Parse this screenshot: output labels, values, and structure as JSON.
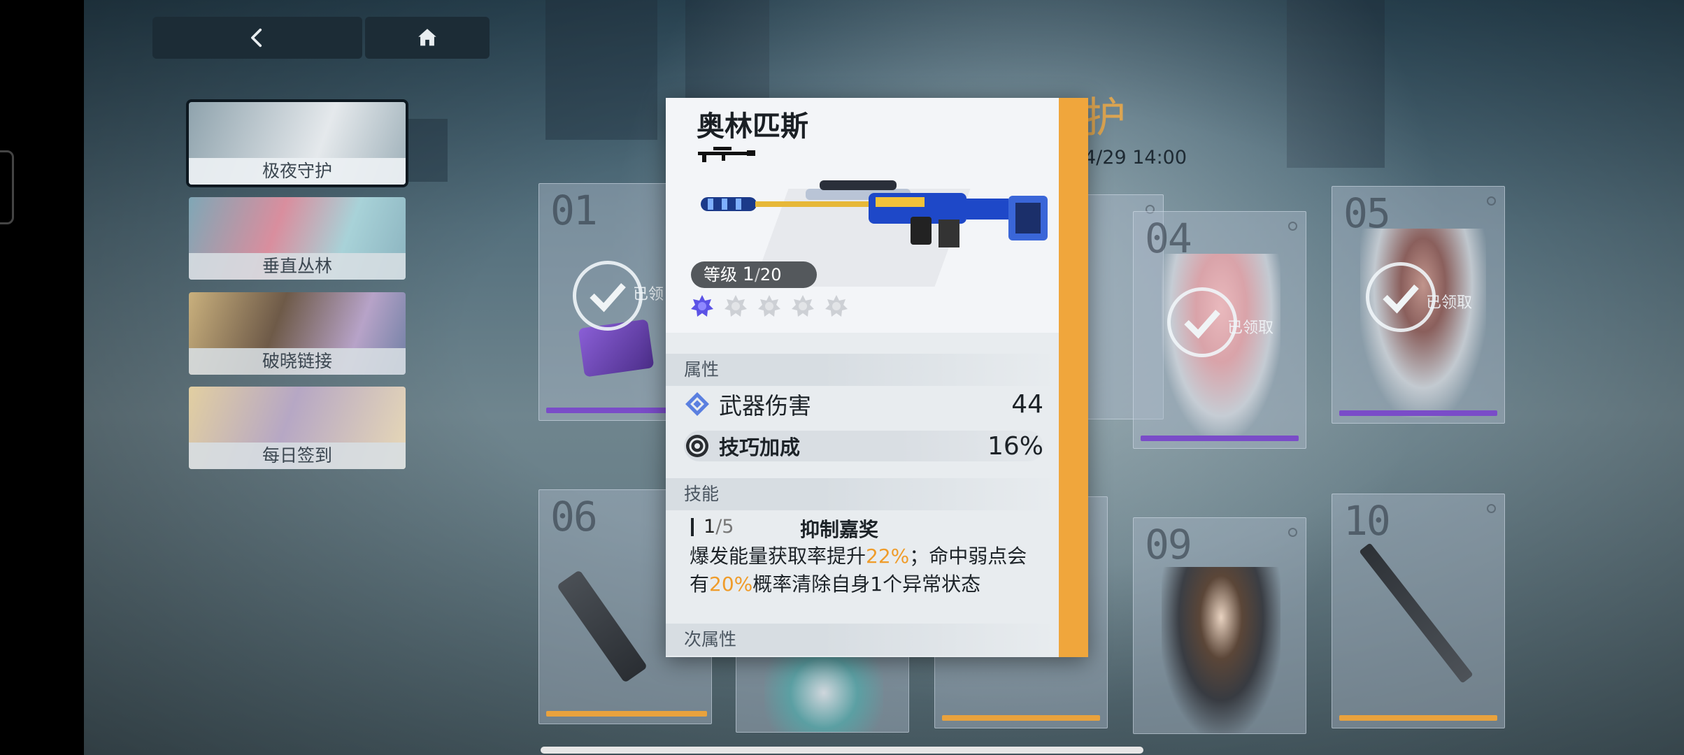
{
  "nav": {
    "back_icon": "chevron-left-icon",
    "home_icon": "home-icon"
  },
  "sidebar": {
    "items": [
      {
        "label": "极夜守护",
        "active": true
      },
      {
        "label": "垂直丛林",
        "active": false
      },
      {
        "label": "破晓链接",
        "active": false
      },
      {
        "label": "每日签到",
        "active": false
      }
    ]
  },
  "background": {
    "partial_title": "护",
    "partial_date": "4/29 14:00"
  },
  "rewards": {
    "cards": [
      {
        "number": "01",
        "claimed": true,
        "claimed_text": "已领"
      },
      {
        "number": "04",
        "claimed": true,
        "claimed_text": "已领取"
      },
      {
        "number": "05",
        "claimed": true,
        "claimed_text": "已领取"
      },
      {
        "number": "06",
        "claimed": false
      },
      {
        "number": "09",
        "claimed": false
      },
      {
        "number": "10",
        "claimed": false
      }
    ]
  },
  "popup": {
    "title": "奥林匹斯",
    "level_label": "等级",
    "level_current": "1",
    "level_max": "20",
    "stars_total": 5,
    "stars_filled": 1,
    "sections": {
      "attributes": "属性",
      "skill": "技能",
      "sub_attributes": "次属性"
    },
    "stats": [
      {
        "name": "武器伤害",
        "value": "44",
        "icon": "weapon-damage-icon"
      },
      {
        "name": "技巧加成",
        "value": "16%",
        "icon": "skill-bonus-icon"
      }
    ],
    "skill": {
      "level": "1",
      "level_max": "5",
      "name": "抑制嘉奖",
      "desc_part1": "爆发能量获取率提升",
      "desc_hl1": "22%",
      "desc_part2": "；命中弱点会有",
      "desc_hl2": "20%",
      "desc_part3": "概率清除自身1个异常状态"
    },
    "colors": {
      "accent": "#f0a63c",
      "highlight": "#ef9c2a",
      "star_active": "#5b52e6"
    }
  }
}
